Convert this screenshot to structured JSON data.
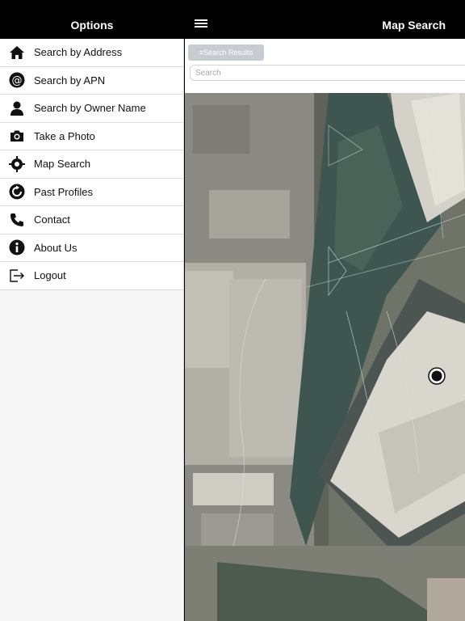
{
  "header": {
    "left_title": "Options",
    "right_title": "Map Search",
    "menu_icon": "hamburger-icon"
  },
  "sidebar": {
    "items": [
      {
        "label": "Search by Address",
        "icon": "home-icon"
      },
      {
        "label": "Search by APN",
        "icon": "at-icon"
      },
      {
        "label": "Search by Owner Name",
        "icon": "person-icon"
      },
      {
        "label": "Take a Photo",
        "icon": "camera-icon"
      },
      {
        "label": "Map Search",
        "icon": "crosshair-icon"
      },
      {
        "label": "Past Profiles",
        "icon": "refresh-icon"
      },
      {
        "label": "Contact",
        "icon": "phone-icon"
      },
      {
        "label": "About Us",
        "icon": "info-icon"
      },
      {
        "label": "Logout",
        "icon": "logout-icon"
      }
    ]
  },
  "main": {
    "search_results_label": "≡Search Results",
    "search_placeholder": "Search",
    "map": {
      "type": "satellite",
      "location_marker": "location-marker-icon"
    }
  },
  "colors": {
    "header_bg": "#000000",
    "sidebar_bg": "#f7f7f7",
    "button_bg": "#c7ccd1"
  }
}
